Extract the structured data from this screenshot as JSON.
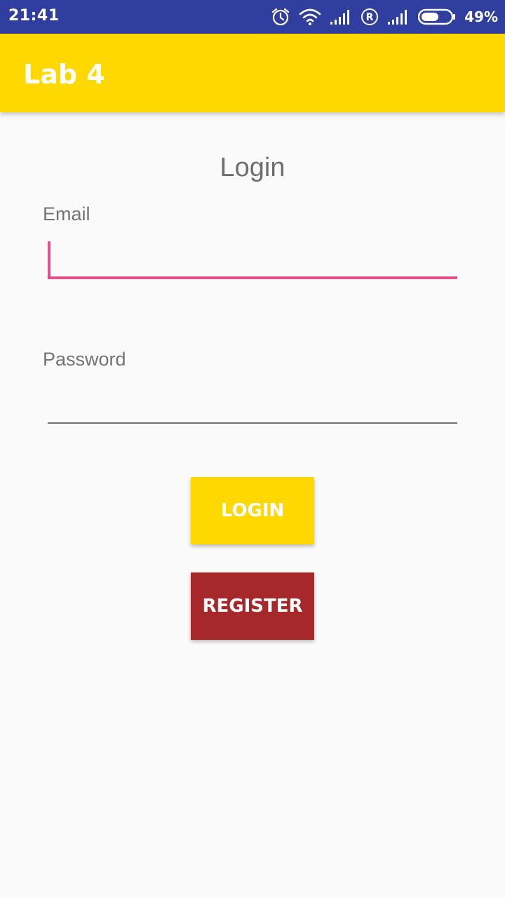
{
  "status_bar": {
    "time": "21:41",
    "battery_percent": "49%",
    "icons": [
      "alarm-icon",
      "wifi-icon",
      "signal-icon",
      "roaming-icon",
      "signal-icon",
      "battery-icon"
    ],
    "background_color": "#303f9f"
  },
  "app_bar": {
    "title": "Lab 4",
    "background_color": "#ffd800"
  },
  "form": {
    "heading": "Login",
    "email": {
      "label": "Email",
      "value": "",
      "placeholder": "",
      "accent_color": "#e5508a"
    },
    "password": {
      "label": "Password",
      "value": "",
      "placeholder": ""
    },
    "login_button": {
      "label": "LOGIN",
      "color": "#ffd800"
    },
    "register_button": {
      "label": "REGISTER",
      "color": "#a6282a"
    }
  }
}
